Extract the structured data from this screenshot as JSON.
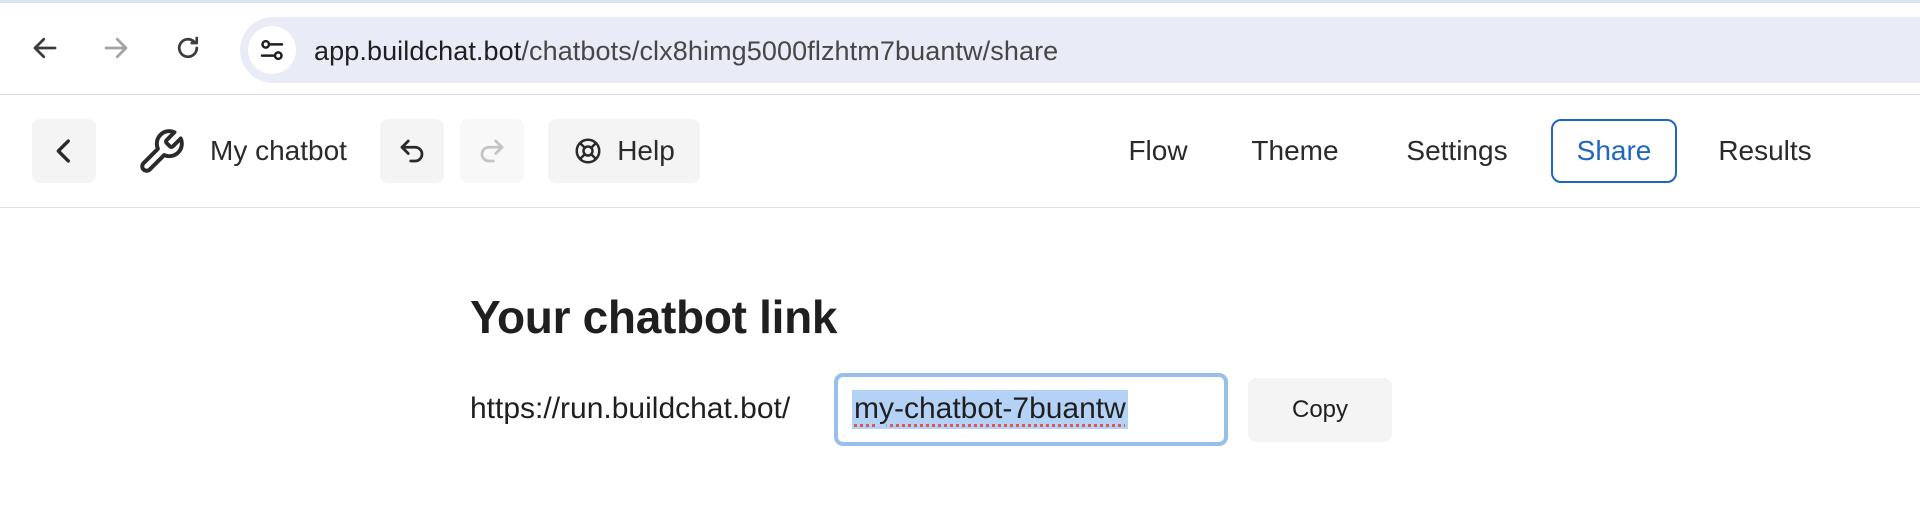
{
  "browser": {
    "url_host": "app.buildchat.bot",
    "url_path": "/chatbots/clx8himg5000flzhtm7buantw/share",
    "icons": {
      "back": "arrow-left-icon",
      "forward": "arrow-right-icon",
      "reload": "reload-icon",
      "site_info": "tune-icon"
    }
  },
  "header": {
    "chatbot_name": "My chatbot",
    "help_label": "Help",
    "tabs": [
      {
        "label": "Flow",
        "active": false
      },
      {
        "label": "Theme",
        "active": false
      },
      {
        "label": "Settings",
        "active": false
      },
      {
        "label": "Share",
        "active": true
      },
      {
        "label": "Results",
        "active": false
      }
    ],
    "icons": {
      "back": "chevron-left-icon",
      "logo": "wrench-icon",
      "undo": "undo-icon",
      "redo": "redo-icon",
      "help": "lifebuoy-icon"
    }
  },
  "share": {
    "title": "Your chatbot link",
    "url_prefix": "https://run.buildchat.bot/",
    "slug_value": "my-chatbot-7buantw",
    "copy_label": "Copy"
  },
  "colors": {
    "accent": "#1f66c1",
    "input_focus_border": "#96bfe9",
    "selection": "#b4d2f5",
    "omnibox_bg": "#e9ecf6"
  }
}
